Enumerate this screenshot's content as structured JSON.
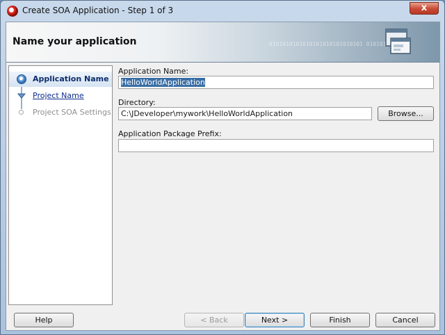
{
  "window": {
    "title": "Create SOA Application - Step 1 of 3",
    "close_glyph": "x"
  },
  "banner": {
    "title": "Name your application",
    "binary_text": "0101010101010101010101010101 01010101010"
  },
  "steps": [
    {
      "label": "Application Name",
      "state": "active"
    },
    {
      "label": "Project Name",
      "state": "link"
    },
    {
      "label": "Project SOA Settings",
      "state": "disabled"
    }
  ],
  "form": {
    "app_name_label": "Application Name:",
    "app_name_value": "HelloWorldApplication",
    "directory_label": "Directory:",
    "directory_value": "C:\\JDeveloper\\mywork\\HelloWorldApplication",
    "browse_label": "Browse...",
    "package_label": "Application Package Prefix:",
    "package_value": ""
  },
  "buttons": {
    "help": "Help",
    "back": "< Back",
    "next": "Next >",
    "finish": "Finish",
    "cancel": "Cancel"
  },
  "colors": {
    "selection": "#3a6ea5",
    "link": "#0d2b8c",
    "active_step": "#0d2e6b"
  }
}
